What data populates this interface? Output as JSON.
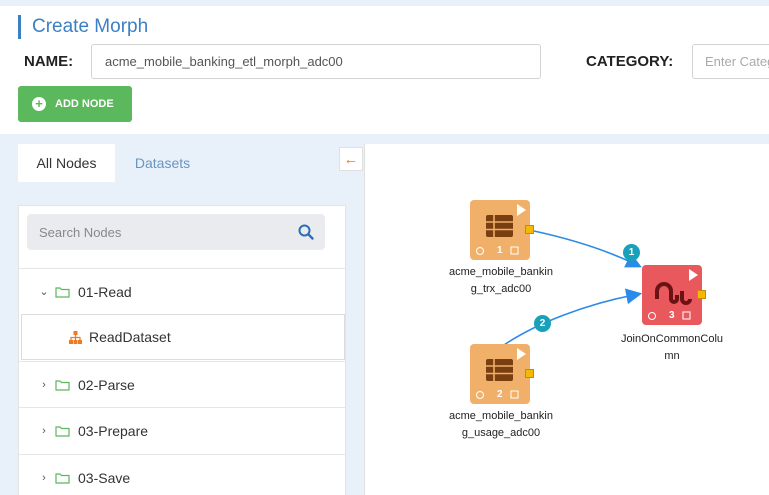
{
  "header": {
    "title": "Create Morph",
    "name_label": "NAME:",
    "name_value": "acme_mobile_banking_etl_morph_adc00",
    "category_label": "CATEGORY:",
    "category_placeholder": "Enter Category"
  },
  "toolbar": {
    "add_node_label": "ADD NODE"
  },
  "tabs": [
    {
      "label": "All Nodes",
      "active": true
    },
    {
      "label": "Datasets",
      "active": false
    }
  ],
  "search": {
    "placeholder": "Search Nodes"
  },
  "tree": [
    {
      "label": "01-Read",
      "expanded": true,
      "icon": "folder-icon"
    },
    {
      "label": "ReadDataset",
      "child": true,
      "icon": "dataset-icon"
    },
    {
      "label": "02-Parse",
      "expanded": false,
      "icon": "folder-icon"
    },
    {
      "label": "03-Prepare",
      "expanded": false,
      "icon": "folder-icon"
    },
    {
      "label": "03-Save",
      "expanded": false,
      "icon": "folder-icon"
    }
  ],
  "nodes": [
    {
      "label": "acme_mobile_banking_trx_adc00",
      "index": "1",
      "color": "#f0b06a",
      "icon": "table-icon"
    },
    {
      "label": "acme_mobile_banking_usage_adc00",
      "index": "2",
      "color": "#f0b06a",
      "icon": "table-icon"
    },
    {
      "label": "JoinOnCommonColumn",
      "index": "3",
      "color": "#e8585c",
      "icon": "join-icon"
    }
  ],
  "edges": [
    {
      "from": "1",
      "to": "3",
      "badge": "1"
    },
    {
      "from": "2",
      "to": "3",
      "badge": "2"
    }
  ],
  "colors": {
    "accent": "#3b7fc4",
    "add_button": "#5cb85c",
    "edge": "#2a8be8",
    "edge_badge": "#1aa0b8",
    "port": "#f5b800",
    "collapse_arrow": "#f07a22"
  }
}
